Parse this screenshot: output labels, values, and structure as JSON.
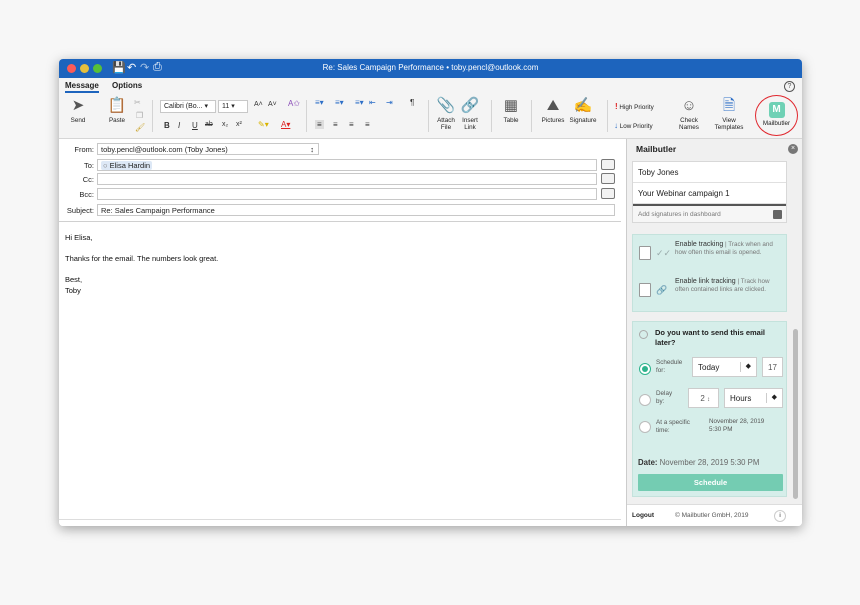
{
  "window": {
    "title": "Re: Sales Campaign Performance  • toby.pencl@outlook.com"
  },
  "ribbon_tabs": [
    "Message",
    "Options"
  ],
  "ribbon": {
    "send": "Send",
    "paste": "Paste",
    "font_name": "Calibri (Bo...",
    "font_size": "11",
    "grow": "A˄",
    "shrink": "A˅",
    "bold": "B",
    "italic": "I",
    "underline": "U",
    "strike": "ab",
    "subscript": "x₂",
    "superscript": "x²",
    "attach_file": [
      "Attach",
      "File"
    ],
    "insert_link": [
      "Insert",
      "Link"
    ],
    "table": "Table",
    "pictures": "Pictures",
    "signature": "Signature",
    "high_priority": "High Priority",
    "low_priority": "Low Priority",
    "check_names": [
      "Check",
      "Names"
    ],
    "view_templates": [
      "View",
      "Templates"
    ],
    "mailbutler": "Mailbutler"
  },
  "header": {
    "from_label": "From:",
    "from_value": "toby.pencl@outlook.com (Toby Jones)",
    "to_label": "To:",
    "to_value": "Elisa Hardin",
    "cc_label": "Cc:",
    "bcc_label": "Bcc:",
    "subject_label": "Subject:",
    "subject_value": "Re: Sales Campaign Performance"
  },
  "body": {
    "greeting": "Hi Elisa,",
    "line1": "Thanks for the email. The numbers look great.",
    "closing": "Best,",
    "name": "Toby"
  },
  "panel": {
    "title": "Mailbutler",
    "signatures": [
      "Toby Jones",
      "Your Webinar campaign 1"
    ],
    "add_signatures": "Add signatures in dashboard",
    "tracking_title": "Enable tracking",
    "tracking_desc_inline": "Track when",
    "tracking_desc": "and how often this email is opened.",
    "link_tracking_title": "Enable link tracking",
    "link_tracking_desc_inline": "Track",
    "link_tracking_desc": "how often contained links are clicked.",
    "schedule_question": "Do you want to send this email later?",
    "schedule_for_label": [
      "Schedule",
      "for:"
    ],
    "schedule_day": "Today",
    "schedule_hour": "17",
    "delay_label": [
      "Delay",
      "by:"
    ],
    "delay_amount": "2",
    "delay_unit": "Hours",
    "specific_label": [
      "At a specific",
      "time:"
    ],
    "specific_value": [
      "November 28, 2019",
      "5:30 PM"
    ],
    "date_label": "Date:",
    "date_value": "November 28, 2019 5:30 PM",
    "schedule_button": "Schedule",
    "logout": "Logout",
    "copyright": "© Mailbutler GmbH, 2019"
  }
}
